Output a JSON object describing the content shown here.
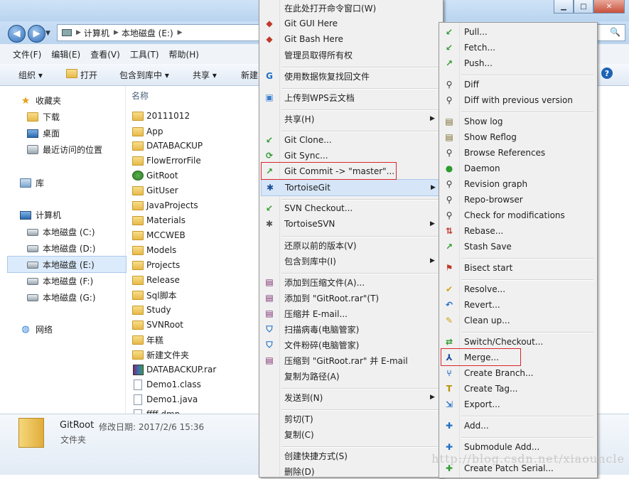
{
  "address": {
    "crumbs": [
      "计算机",
      "本地磁盘 (E:)"
    ]
  },
  "menubar": [
    "文件(F)",
    "编辑(E)",
    "查看(V)",
    "工具(T)",
    "帮助(H)"
  ],
  "toolbar": {
    "organize": "组织 ▾",
    "open": "打开",
    "include": "包含到库中 ▾",
    "share": "共享 ▾",
    "new": "新建"
  },
  "navpane": {
    "favorites": "收藏夹",
    "downloads": "下载",
    "desktop": "桌面",
    "recent": "最近访问的位置",
    "libraries": "库",
    "computer": "计算机",
    "drives": [
      "本地磁盘 (C:)",
      "本地磁盘 (D:)",
      "本地磁盘 (E:)",
      "本地磁盘 (F:)",
      "本地磁盘 (G:)"
    ],
    "network": "网络"
  },
  "filelist": {
    "header": "名称",
    "files": [
      "20111012",
      "App",
      "DATABACKUP",
      "FlowErrorFile",
      "GitRoot",
      "GitUser",
      "JavaProjects",
      "Materials",
      "MCCWEB",
      "Models",
      "Projects",
      "Release",
      "Sql脚本",
      "Study",
      "SVNRoot",
      "年糕",
      "新建文件夹",
      "DATABACKUP.rar",
      "Demo1.class",
      "Demo1.java",
      "ffff.dmp"
    ]
  },
  "details": {
    "name": "GitRoot",
    "modified_label": "修改日期: 2017/2/6 15:36",
    "type": "文件夹"
  },
  "context_menu": [
    {
      "label": "在此处打开命令窗口(W)"
    },
    {
      "label": "Git GUI Here"
    },
    {
      "label": "Git Bash Here"
    },
    {
      "label": "管理员取得所有权"
    },
    {
      "label": "使用数据恢复找回文件"
    },
    {
      "label": "上传到WPS云文档"
    },
    {
      "label": "共享(H)"
    },
    {
      "label": "Git Clone..."
    },
    {
      "label": "Git Sync..."
    },
    {
      "label": "Git Commit -> \"master\"..."
    },
    {
      "label": "TortoiseGit"
    },
    {
      "label": "SVN Checkout..."
    },
    {
      "label": "TortoiseSVN"
    },
    {
      "label": "还原以前的版本(V)"
    },
    {
      "label": "包含到库中(I)"
    },
    {
      "label": "添加到压缩文件(A)..."
    },
    {
      "label": "添加到 \"GitRoot.rar\"(T)"
    },
    {
      "label": "压缩并 E-mail..."
    },
    {
      "label": "扫描病毒(电脑管家)"
    },
    {
      "label": "文件粉碎(电脑管家)"
    },
    {
      "label": "压缩到 \"GitRoot.rar\" 并 E-mail"
    },
    {
      "label": "复制为路径(A)"
    },
    {
      "label": "发送到(N)"
    },
    {
      "label": "剪切(T)"
    },
    {
      "label": "复制(C)"
    },
    {
      "label": "创建快捷方式(S)"
    },
    {
      "label": "删除(D)"
    }
  ],
  "submenu": [
    {
      "label": "Pull..."
    },
    {
      "label": "Fetch..."
    },
    {
      "label": "Push..."
    },
    {
      "label": "Diff"
    },
    {
      "label": "Diff with previous version"
    },
    {
      "label": "Show log"
    },
    {
      "label": "Show Reflog"
    },
    {
      "label": "Browse References"
    },
    {
      "label": "Daemon"
    },
    {
      "label": "Revision graph"
    },
    {
      "label": "Repo-browser"
    },
    {
      "label": "Check for modifications"
    },
    {
      "label": "Rebase..."
    },
    {
      "label": "Stash Save"
    },
    {
      "label": "Bisect start"
    },
    {
      "label": "Resolve..."
    },
    {
      "label": "Revert..."
    },
    {
      "label": "Clean up..."
    },
    {
      "label": "Switch/Checkout..."
    },
    {
      "label": "Merge..."
    },
    {
      "label": "Create Branch..."
    },
    {
      "label": "Create Tag..."
    },
    {
      "label": "Export..."
    },
    {
      "label": "Add..."
    },
    {
      "label": "Submodule Add..."
    },
    {
      "label": "Create Patch Serial..."
    }
  ],
  "watermark": "http://blog.csdn.net/xiaouncle"
}
